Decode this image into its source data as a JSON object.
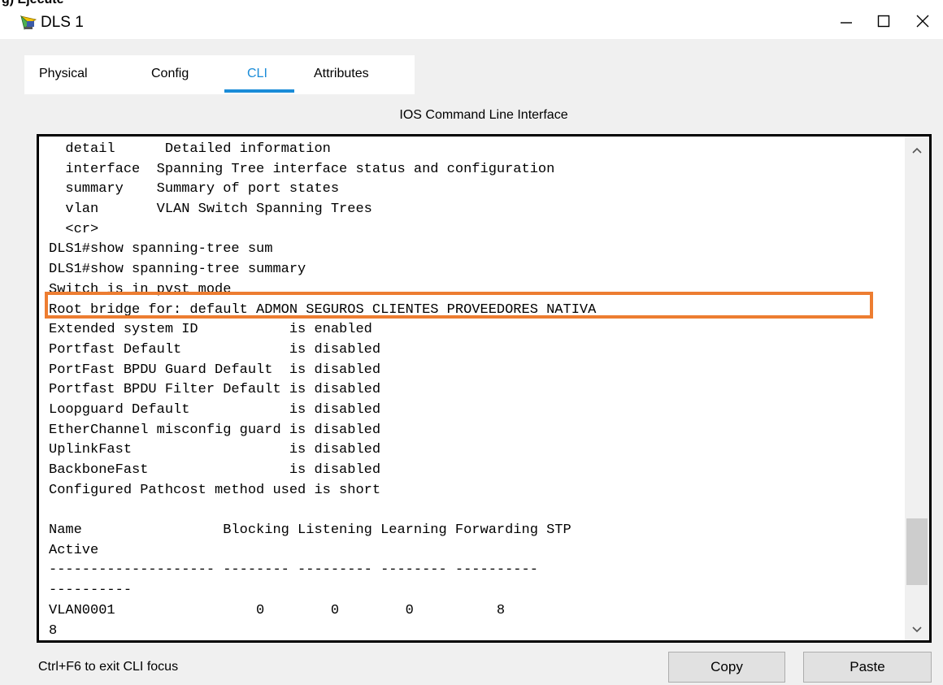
{
  "window": {
    "clipped_heading": "g) Ejecute",
    "title": "DLS 1",
    "app_icon": "packet-tracer-device-icon",
    "controls": {
      "minimize": "minimize-icon",
      "maximize": "maximize-icon",
      "close": "close-icon"
    }
  },
  "tabs": [
    {
      "label": "Physical"
    },
    {
      "label": "Config"
    },
    {
      "label": "CLI",
      "active": true
    },
    {
      "label": "Attributes"
    }
  ],
  "panel_title": "IOS Command Line Interface",
  "cli": {
    "lines": [
      "  detail      Detailed information",
      "  interface  Spanning Tree interface status and configuration",
      "  summary    Summary of port states",
      "  vlan       VLAN Switch Spanning Trees",
      "  <cr>",
      "DLS1#show spanning-tree sum",
      "DLS1#show spanning-tree summary",
      "Switch is in pvst mode",
      "Root bridge for: default ADMON SEGUROS CLIENTES PROVEEDORES NATIVA",
      "Extended system ID           is enabled",
      "Portfast Default             is disabled",
      "PortFast BPDU Guard Default  is disabled",
      "Portfast BPDU Filter Default is disabled",
      "Loopguard Default            is disabled",
      "EtherChannel misconfig guard is disabled",
      "UplinkFast                   is disabled",
      "BackboneFast                 is disabled",
      "Configured Pathcost method used is short",
      "",
      "Name                 Blocking Listening Learning Forwarding STP",
      "Active",
      "-------------------- -------- --------- -------- ----------",
      "----------",
      "VLAN0001                 0        0        0          8",
      "8"
    ],
    "highlight_color": "#ed7d31"
  },
  "status": {
    "hint": "Ctrl+F6 to exit CLI focus"
  },
  "buttons": {
    "copy": "Copy",
    "paste": "Paste"
  },
  "colors": {
    "accent": "#1a8cd8",
    "background": "#f0f0f0"
  }
}
